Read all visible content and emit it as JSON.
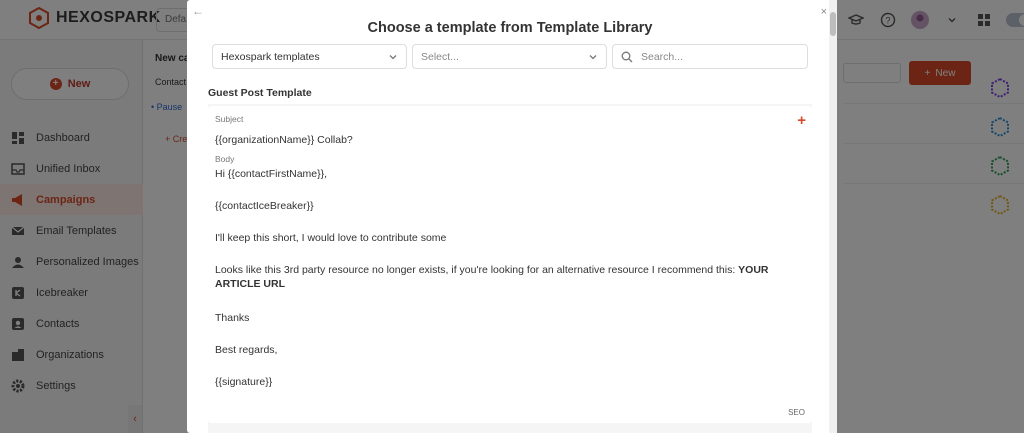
{
  "app": {
    "brand": "HEXOSPARK",
    "workspace_select": "Defa",
    "new_button": "New",
    "nav": [
      {
        "label": "Dashboard",
        "icon": "dashboard-icon"
      },
      {
        "label": "Unified Inbox",
        "icon": "inbox-icon"
      },
      {
        "label": "Campaigns",
        "icon": "megaphone-icon",
        "active": true
      },
      {
        "label": "Email Templates",
        "icon": "mail-icon"
      },
      {
        "label": "Personalized Images",
        "icon": "people-icon"
      },
      {
        "label": "Icebreaker",
        "icon": "icebreaker-icon"
      },
      {
        "label": "Contacts",
        "icon": "contact-card-icon"
      },
      {
        "label": "Organizations",
        "icon": "building-icon"
      },
      {
        "label": "Settings",
        "icon": "gear-icon"
      }
    ],
    "main": {
      "heading": "New ca",
      "contact_label": "Contact",
      "pause_text": "• Pause",
      "create_text": "+ Cre",
      "new_button": "New"
    },
    "colors": {
      "accent": "#d94b2b",
      "link": "#2e6bd1"
    }
  },
  "modal": {
    "back_icon": "←",
    "close_icon": "×",
    "title": "Choose a template from Template Library",
    "library_select": "Hexospark templates",
    "category_select_placeholder": "Select...",
    "search_placeholder": "Search...",
    "template": {
      "name": "Guest Post Template",
      "subject_label": "Subject",
      "subject": "{{organizationName}} Collab?",
      "body_label": "Body",
      "body_greeting": "Hi {{contactFirstName}},",
      "body_icebreaker": "{{contactIceBreaker}}",
      "body_line1": "I'll keep this short, I would love to contribute some",
      "body_line2_prefix": "Looks like this 3rd party resource no longer exists, if you're looking for an alternative resource I recommend this: ",
      "body_line2_bold": "YOUR ARTICLE URL",
      "body_thanks": "Thanks",
      "body_regards": "Best regards,",
      "body_signature": "{{signature}}",
      "tag": "SEO"
    }
  }
}
